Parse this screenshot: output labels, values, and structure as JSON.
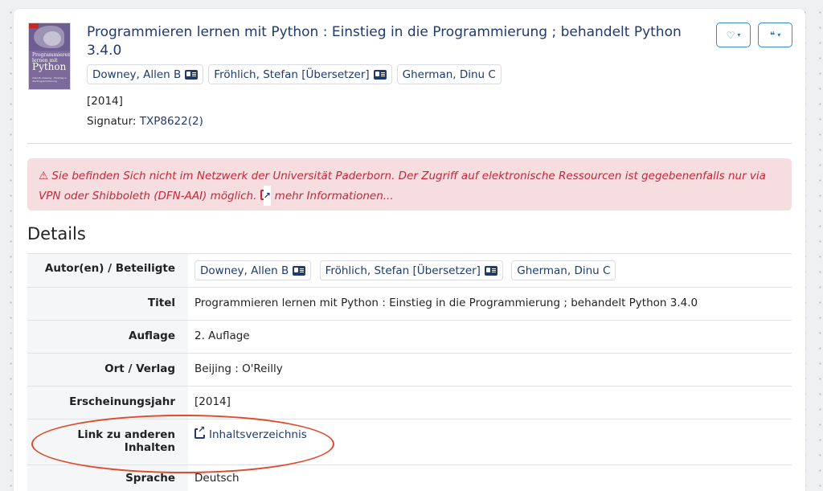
{
  "record": {
    "title": "Programmieren lernen mit Python : Einstieg in die Programmierung ; behandelt Python 3.4.0",
    "authors": [
      "Downey, Allen B",
      "Fröhlich, Stefan [Übersetzer]",
      "Gherman, Dinu C"
    ],
    "year": "[2014]",
    "signature_label": "Signatur:",
    "signature_value": "TXP8622(2)",
    "cover": {
      "title_small": "Programmieren lernen mit",
      "title_big": "Python",
      "tagline": "Allen B. Downey · Einstieg in die Programmierung"
    }
  },
  "toolbar": {
    "favorite_icon": "heart-icon",
    "cite_icon": "quote-icon",
    "favorite_glyph": "♡",
    "cite_glyph": "❝",
    "caret": "▾"
  },
  "alert": {
    "icon": "⚠",
    "text": "Sie befinden Sich nicht im Netzwerk der Universität Paderborn. Der Zugriff auf elektronische Ressourcen ist gegebenenfalls nur via VPN oder Shibboleth (DFN-AAI) möglich.",
    "link": "mehr Informationen..."
  },
  "details": {
    "heading": "Details",
    "rows": {
      "authors_label": "Autor(en) / Beteiligte",
      "title_label": "Titel",
      "title_value": "Programmieren lernen mit Python : Einstieg in die Programmierung ; behandelt Python 3.4.0",
      "edition_label": "Auflage",
      "edition_value": "2. Auflage",
      "place_label": "Ort / Verlag",
      "place_value": "Beijing : O'Reilly",
      "year_label": "Erscheinungsjahr",
      "year_value": "[2014]",
      "link_label": "Link zu anderen Inhalten",
      "link_value": "Inhaltsverzeichnis",
      "language_label": "Sprache",
      "language_value": "Deutsch"
    }
  },
  "colors": {
    "link": "#1f3a6e",
    "alert_bg": "#f6dde0",
    "alert_text": "#c2283b",
    "annotation": "#e0492a",
    "button_border": "#3a8bc9"
  }
}
